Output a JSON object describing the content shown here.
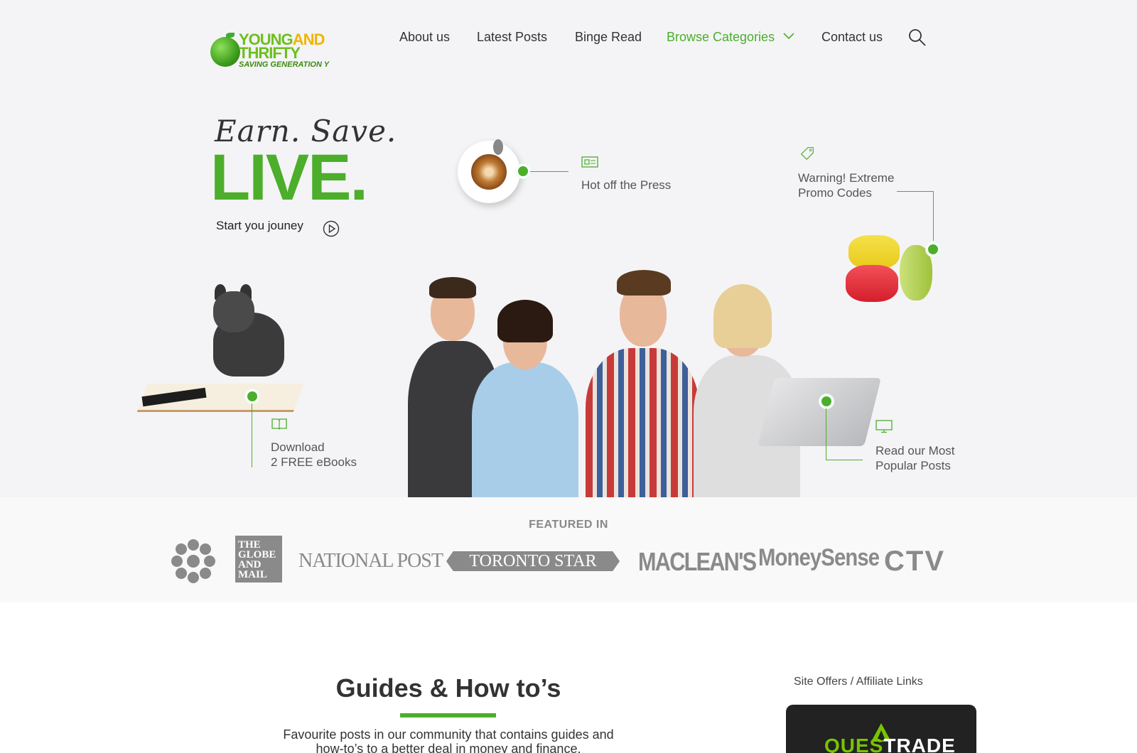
{
  "brand": {
    "logo_line1a": "YOUNG",
    "logo_line1b": "AND",
    "logo_line2": "THRIFTY",
    "logo_tagline": "SAVING GENERATION Y"
  },
  "nav": {
    "items": [
      {
        "label": "About us"
      },
      {
        "label": "Latest Posts"
      },
      {
        "label": "Binge Read"
      },
      {
        "label": "Browse Categories"
      },
      {
        "label": "Contact us"
      }
    ]
  },
  "hero": {
    "script_line": "Earn. Save.",
    "headline": "LIVE.",
    "cta": "Start you jouney",
    "callouts": {
      "press": "Hot off the Press",
      "promo_line1": "Warning! Extreme",
      "promo_line2": "Promo Codes",
      "ebooks_line1": "Download",
      "ebooks_line2": "2 FREE eBooks",
      "popular_line1": "Read our Most",
      "popular_line2": "Popular Posts"
    }
  },
  "featured": {
    "label": "FEATURED IN",
    "outlets": {
      "globe": "THE GLOBE AND MAIL",
      "national_post": "NATIONAL POST",
      "toronto_star": "TORONTO STAR",
      "macleans": "MACLEAN'S",
      "moneysense": "MoneySense",
      "ctv": "CTV"
    }
  },
  "guides": {
    "title": "Guides & How to’s",
    "description": "Favourite posts in our community that contains guides and how-to’s to a better deal in money and finance."
  },
  "sidebar": {
    "offers_title": "Site Offers / Affiliate Links",
    "ad_brand_a": "QUES",
    "ad_brand_b": "TRADE"
  },
  "colors": {
    "accent": "#4cae2b",
    "hero_bg": "#f4f4f6",
    "featured_bg": "#f9f9f9"
  }
}
